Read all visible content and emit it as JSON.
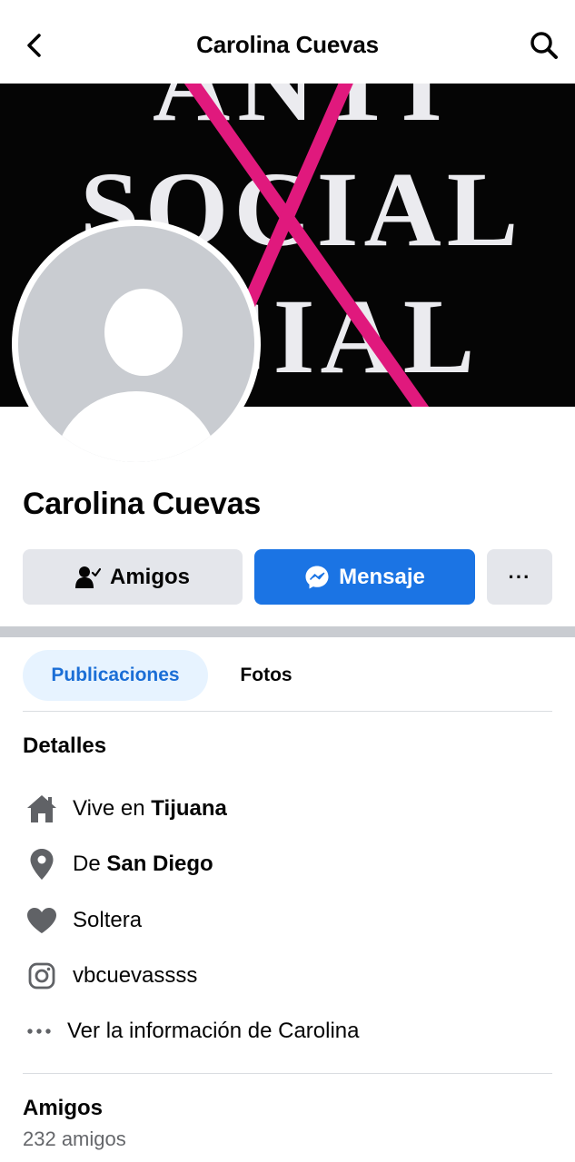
{
  "header": {
    "title": "Carolina Cuevas"
  },
  "profile": {
    "name": "Carolina Cuevas",
    "cover_text": [
      "ANTI",
      "SOCIAL",
      "SOCIAL"
    ]
  },
  "actions": {
    "friends_label": "Amigos",
    "message_label": "Mensaje",
    "more_label": "···"
  },
  "tabs": [
    {
      "label": "Publicaciones",
      "active": true
    },
    {
      "label": "Fotos",
      "active": false
    }
  ],
  "details": {
    "title": "Detalles",
    "lives_prefix": "Vive en ",
    "lives_city": "Tijuana",
    "from_prefix": "De ",
    "from_city": "San Diego",
    "relationship": "Soltera",
    "instagram": "vbcuevassss",
    "more_info": "Ver la información de Carolina"
  },
  "friends": {
    "title": "Amigos",
    "count_text": "232 amigos"
  },
  "colors": {
    "accent": "#1b74e4",
    "accent_text": "#1b6ed6",
    "tab_bg": "#e7f3ff",
    "button_bg": "#e4e6eb",
    "icon": "#606266",
    "cover_cross": "#e0197d"
  }
}
